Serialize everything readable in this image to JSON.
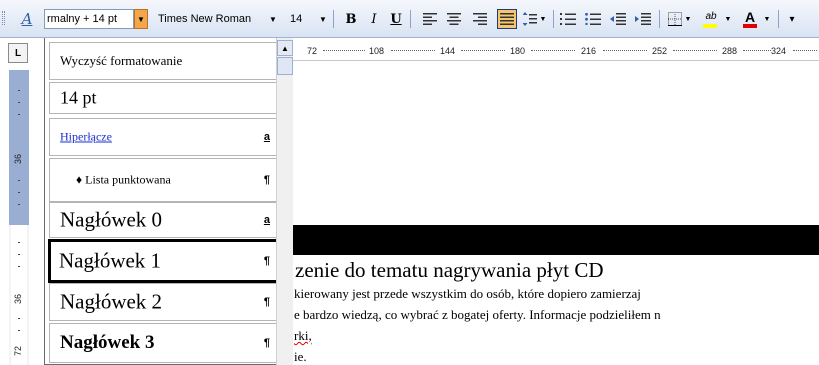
{
  "toolbar": {
    "style_combo_value": "rmalny + 14 pt",
    "font_combo_value": "Times New Roman",
    "size_combo_value": "14",
    "bold_label": "B",
    "italic_label": "I",
    "underline_label": "U",
    "highlight_label": "ab",
    "font_color_label": "A",
    "highlight_color": "#ffff00",
    "font_color": "#e00000",
    "icons": [
      "styles-icon",
      "align-left-icon",
      "align-center-icon",
      "align-right-icon",
      "justify-icon",
      "line-spacing-icon",
      "numbering-icon",
      "bullets-icon",
      "decrease-indent-icon",
      "increase-indent-icon",
      "borders-icon",
      "highlight-icon",
      "font-color-icon"
    ]
  },
  "tab_selector": "L",
  "vertical_ruler": {
    "labels": [
      "36",
      "36",
      "72"
    ]
  },
  "horizontal_ruler": {
    "labels": [
      "72",
      "108",
      "144",
      "180",
      "216",
      "252",
      "288",
      "324"
    ]
  },
  "style_dropdown": {
    "items": [
      {
        "label": "Wyczyść formatowanie",
        "mark": ""
      },
      {
        "label": "14 pt",
        "mark": ""
      },
      {
        "label": "Hiperłącze",
        "mark": "a"
      },
      {
        "label": "♦ Lista punktowana",
        "mark": "¶"
      },
      {
        "label": "Nagłówek 0",
        "mark": "a"
      },
      {
        "label": "Nagłówek 1",
        "mark": "¶",
        "selected": true
      },
      {
        "label": "Nagłówek 2",
        "mark": "¶"
      },
      {
        "label": "Nagłówek 3",
        "mark": "¶"
      }
    ]
  },
  "document": {
    "heading": "zenie do tematu nagrywania płyt CD",
    "lines": [
      "kierowany jest przede wszystkim do osób, które dopiero zamierzaj",
      "e bardzo wiedzą, co wybrać z bogatej oferty. Informacje podzieliłem n",
      "rki,",
      "ie."
    ]
  }
}
